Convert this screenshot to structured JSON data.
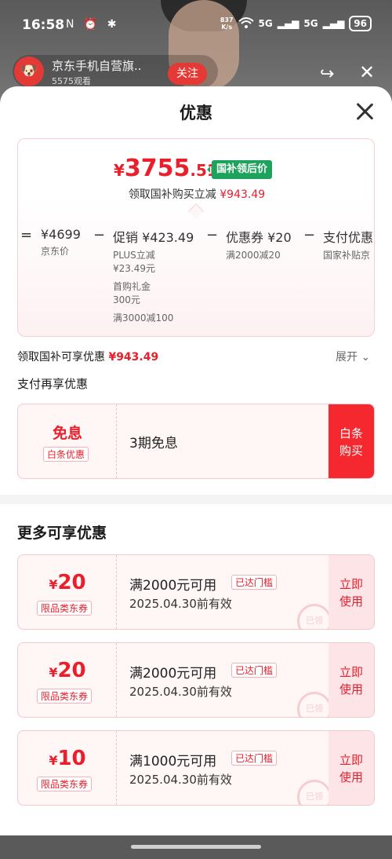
{
  "status_bar": {
    "time": "16:58",
    "left_icons": "N ⏰ ✱",
    "net_speed_value": "837",
    "net_speed_unit": "K/s",
    "signal1": "5G",
    "signal2": "5G",
    "battery": "96"
  },
  "live": {
    "shop_name": "京东手机自营旗..",
    "viewers": "5575观看",
    "follow_label": "关注"
  },
  "sheet": {
    "title": "优惠",
    "price_card": {
      "currency": "¥",
      "price_int": "3755",
      "price_dec": ".51",
      "badge": "国补领后价",
      "subline_prefix": "领取国补购买立减",
      "subline_amount": "¥943.49",
      "breakdown": [
        {
          "op": "=",
          "main": "¥4699",
          "subs": [
            "京东价"
          ]
        },
        {
          "op": "−",
          "main": "促销 ¥423.49",
          "subs": [
            "PLUS立减",
            "¥23.49元",
            "首购礼金",
            "300元",
            "满3000减100"
          ]
        },
        {
          "op": "−",
          "main": "优惠券 ¥20",
          "subs": [
            "满2000减20"
          ]
        },
        {
          "op": "−",
          "main": "支付优惠",
          "subs": [
            "国家补贴京"
          ]
        }
      ]
    },
    "share_line_prefix": "领取国补可享优惠",
    "share_line_amount": "¥943.49",
    "expand_label": "展开 ⌄",
    "pay_more_label": "支付再享优惠",
    "baitiao": {
      "big": "免息",
      "tag": "白条优惠",
      "desc": "3期免息",
      "button": "白条购买"
    },
    "more_title": "更多可享优惠",
    "coupons": [
      {
        "currency": "¥",
        "amount": "20",
        "type": "限品类东券",
        "condition": "满2000元可用",
        "tag": "已达门槛",
        "valid": "2025.04.30前有效",
        "stamp": "已领",
        "button": "立即使用"
      },
      {
        "currency": "¥",
        "amount": "20",
        "type": "限品类东券",
        "condition": "满2000元可用",
        "tag": "已达门槛",
        "valid": "2025.04.30前有效",
        "stamp": "已领",
        "button": "立即使用"
      },
      {
        "currency": "¥",
        "amount": "10",
        "type": "限品类东券",
        "condition": "满1000元可用",
        "tag": "已达门槛",
        "valid": "2025.04.30前有效",
        "stamp": "已领",
        "button": "立即使用"
      }
    ]
  },
  "colors": {
    "accent": "#e9202c",
    "badge_green": "#1ea35d",
    "button_red": "#f5282f"
  }
}
